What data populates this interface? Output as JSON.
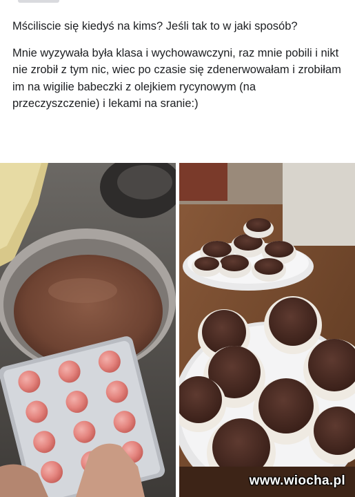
{
  "post": {
    "question": "Mściliscie się kiedyś na kims? Jeśli tak to w jaki sposób?",
    "body": "Mnie wyzywała była klasa i wychowawczyni, raz mnie pobili i nikt nie zrobił z tym nic, wiec po czasie się zdenerwowałam i zrobiłam im na wigilie babeczki z olejkiem rycynowym (na przeczyszczenie) i lekami na sranie:)"
  },
  "photos": [
    {
      "subject": "pan-of-chocolate-batter-with-pill-blister"
    },
    {
      "subject": "plates-of-chocolate-muffins"
    }
  ],
  "watermark": "www.wiocha.pl",
  "colors": {
    "text": "#1c1e21",
    "background": "#ffffff"
  }
}
